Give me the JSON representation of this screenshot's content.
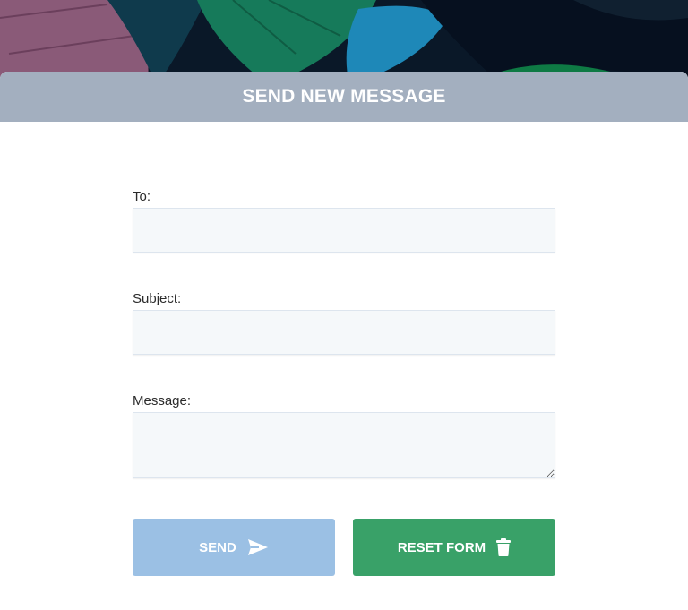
{
  "header": {
    "title": "SEND NEW MESSAGE"
  },
  "form": {
    "to": {
      "label": "To:",
      "value": "",
      "placeholder": ""
    },
    "subject": {
      "label": "Subject:",
      "value": "",
      "placeholder": ""
    },
    "message": {
      "label": "Message:",
      "value": "",
      "placeholder": ""
    }
  },
  "buttons": {
    "send": {
      "label": "SEND",
      "icon": "paper-plane-icon",
      "color": "#9bc0e4"
    },
    "reset": {
      "label": "RESET FORM",
      "icon": "trash-icon",
      "color": "#39a168"
    }
  },
  "colors": {
    "header_bg": "#a3afbf",
    "input_bg": "#f5f8fa"
  }
}
